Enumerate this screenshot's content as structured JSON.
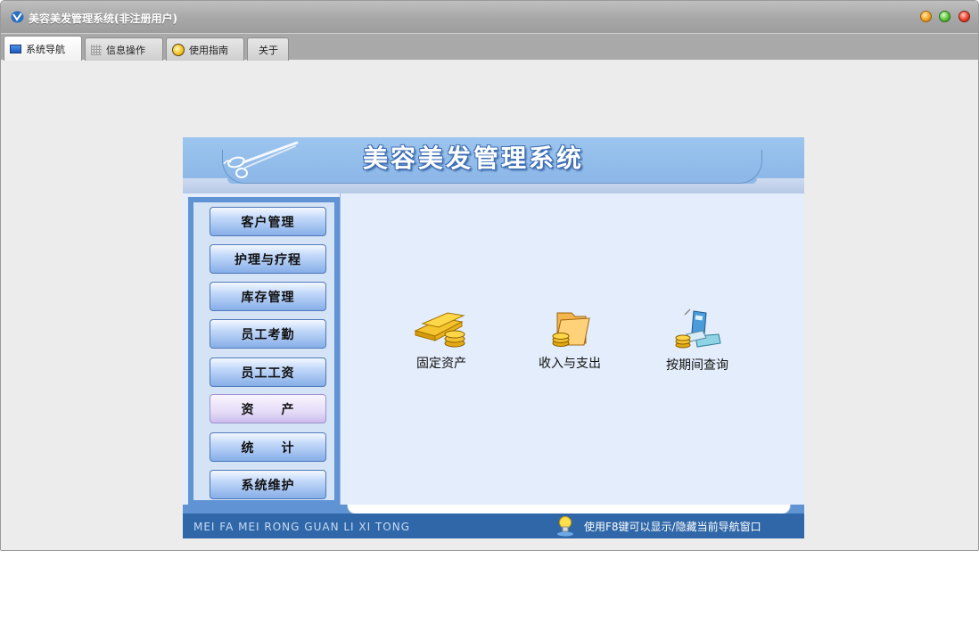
{
  "window": {
    "title": "美容美发管理系统(非注册用户)"
  },
  "tabs": [
    {
      "label": "系统导航",
      "icon": "monitor-icon",
      "active": true
    },
    {
      "label": "信息操作",
      "icon": "grid-icon",
      "active": false
    },
    {
      "label": "使用指南",
      "icon": "guide-icon",
      "active": false
    },
    {
      "label": "关于",
      "icon": "",
      "active": false
    }
  ],
  "panel": {
    "title": "美容美发管理系统",
    "nav": [
      {
        "label": "客户管理"
      },
      {
        "label": "护理与疗程"
      },
      {
        "label": "库存管理"
      },
      {
        "label": "员工考勤"
      },
      {
        "label": "员工工资"
      },
      {
        "label": "资　　产",
        "selected": true
      },
      {
        "label": "统　　计"
      },
      {
        "label": "系统维护"
      }
    ],
    "items": [
      {
        "label": "固定资产",
        "icon": "gold-bars-coins-icon"
      },
      {
        "label": "收入与支出",
        "icon": "folder-coins-icon"
      },
      {
        "label": "按期间查询",
        "icon": "calculator-coins-icon"
      }
    ],
    "footer_left": "MEI FA MEI RONG GUAN LI XI TONG",
    "footer_hint": "使用F8键可以显示/隐藏当前导航窗口"
  },
  "colors": {
    "titlebar": "#a7a7a7",
    "panel_blue": "#5f93d3",
    "footer_blue": "#2f67a8",
    "content_bg": "#e3edfb"
  }
}
